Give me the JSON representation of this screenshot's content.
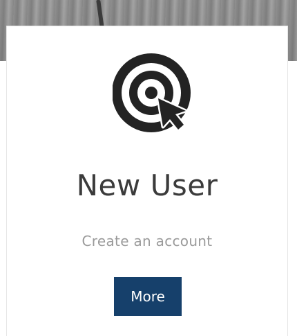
{
  "card": {
    "icon": "target-cursor-icon",
    "title": "New User",
    "subtitle": "Create an account",
    "button_label": "More"
  },
  "colors": {
    "button_bg": "#16406b",
    "button_text": "#ffffff",
    "title": "#3b3b3b",
    "subtitle": "#9a9a9a",
    "icon": "#232323"
  }
}
